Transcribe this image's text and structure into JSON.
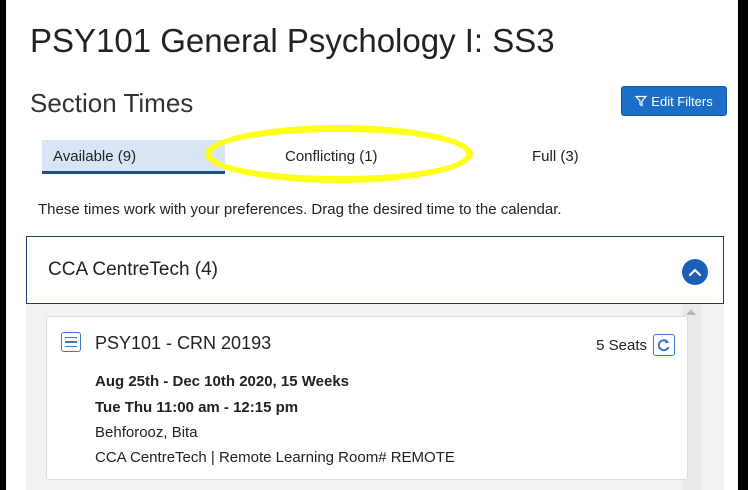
{
  "header": {
    "course_title": "PSY101 General Psychology I: SS3",
    "section_title": "Section Times",
    "edit_filters_label": "Edit Filters"
  },
  "tabs": [
    {
      "label": "Available (9)",
      "selected": true
    },
    {
      "label": "Conflicting (1)",
      "selected": false
    },
    {
      "label": "Full (3)",
      "selected": false
    }
  ],
  "info_text": "These times work with your preferences. Drag the desired time to the calendar.",
  "campus_group": {
    "label": "CCA CentreTech (4)",
    "expanded": true
  },
  "sections": [
    {
      "title": "PSY101 - CRN 20193",
      "seats": "5 Seats",
      "dates": "Aug 25th - Dec 10th 2020, 15 Weeks",
      "schedule": "Tue Thu 11:00 am - 12:15 pm",
      "instructor": "Behforooz, Bita",
      "location": "CCA CentreTech | Remote Learning Room# REMOTE"
    }
  ],
  "colors": {
    "accent": "#1a6fc9",
    "highlight": "#ffff1a",
    "tab_selected_bg": "#d8e5f5"
  }
}
